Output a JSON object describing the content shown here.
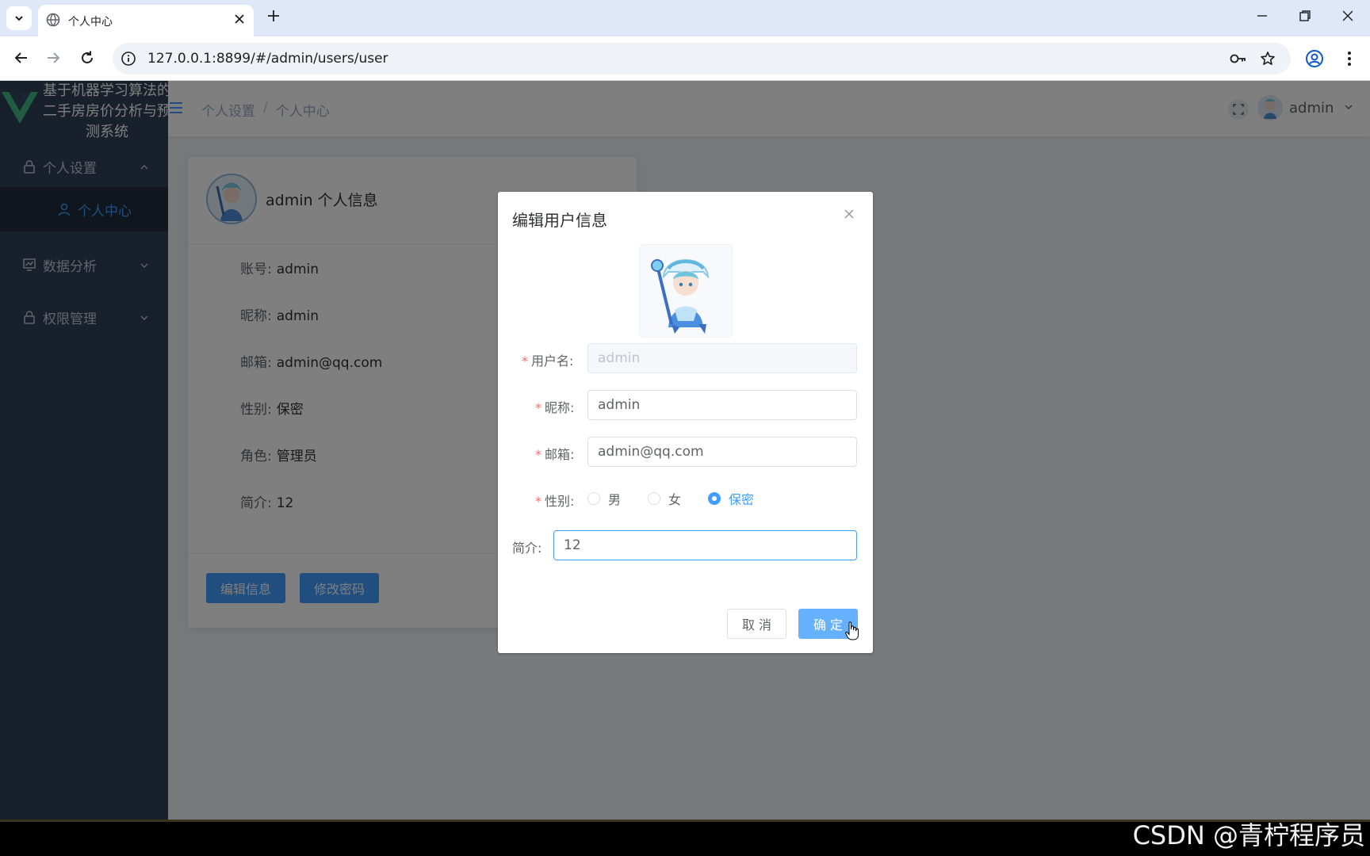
{
  "browser": {
    "tab_title": "个人中心",
    "url": "127.0.0.1:8899/#/admin/users/user"
  },
  "sidebar": {
    "app_title": "基于机器学习算法的二手房房价分析与预测系统",
    "items": [
      {
        "label": "个人设置",
        "icon": "lock-icon",
        "expanded": true
      },
      {
        "label": "数据分析",
        "icon": "chart-icon",
        "expanded": false
      },
      {
        "label": "权限管理",
        "icon": "lock-icon",
        "expanded": false
      }
    ],
    "active_sub_item": {
      "label": "个人中心",
      "icon": "user-icon"
    }
  },
  "navbar": {
    "breadcrumb": [
      "个人设置",
      "个人中心"
    ],
    "username": "admin"
  },
  "profile_card": {
    "title": "admin 个人信息",
    "fields": [
      {
        "label": "账号:",
        "value": "admin"
      },
      {
        "label": "昵称:",
        "value": "admin"
      },
      {
        "label": "邮箱:",
        "value": "admin@qq.com"
      },
      {
        "label": "性别:",
        "value": "保密"
      },
      {
        "label": "角色:",
        "value": "管理员"
      },
      {
        "label": "简介:",
        "value": "12"
      }
    ],
    "edit_button": "编辑信息",
    "password_button": "修改密码"
  },
  "dialog": {
    "title": "编辑用户信息",
    "username_label": "用户名:",
    "username_value": "admin",
    "nickname_label": "昵称:",
    "nickname_value": "admin",
    "email_label": "邮箱:",
    "email_value": "admin@qq.com",
    "gender_label": "性别:",
    "gender_options": [
      "男",
      "女",
      "保密"
    ],
    "gender_selected": "保密",
    "bio_label": "简介:",
    "bio_value": "12",
    "cancel_label": "取 消",
    "ok_label": "确 定"
  },
  "watermark": "CSDN @青柠程序员",
  "colors": {
    "primary": "#409eff",
    "sidebar_bg": "#304156",
    "required": "#f56c6c"
  }
}
